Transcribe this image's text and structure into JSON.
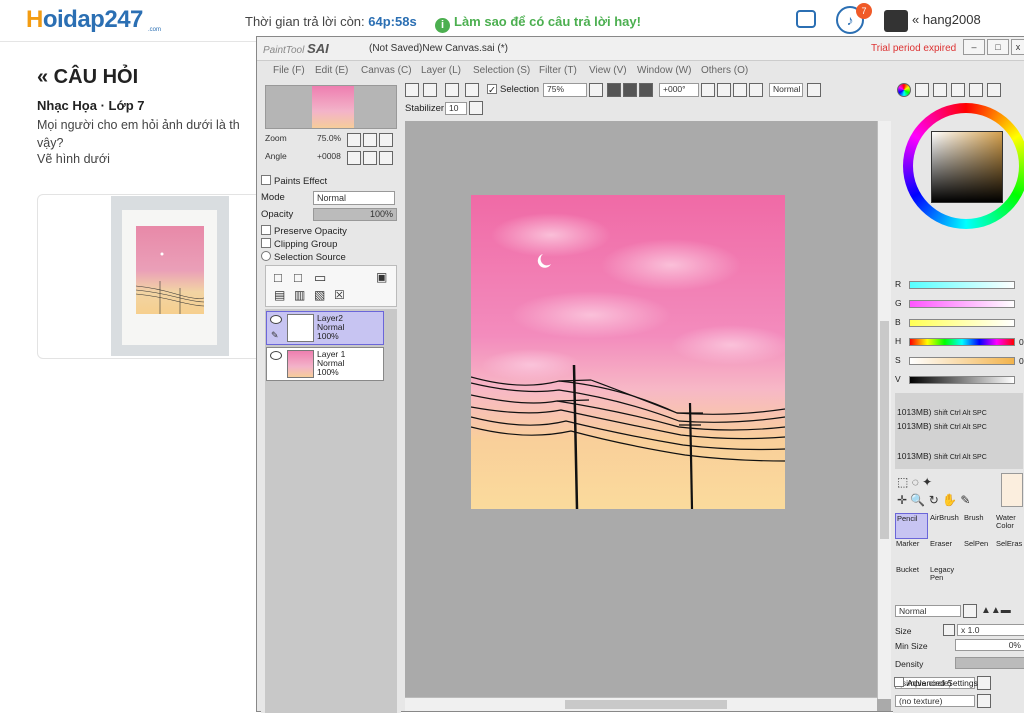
{
  "site": {
    "logo_part1": "H",
    "logo_part2": "oidap247",
    "logo_sub": ".com",
    "timer_label": "Thời gian trả lời còn:",
    "timer_value": "64p:58s",
    "tip_icon": "i",
    "tip": "Làm sao để có câu trả lời hay!",
    "notifications": "7",
    "username": "hang2008",
    "accent_color": "#2b6fb3"
  },
  "question": {
    "title": "« CÂU HỎI",
    "meta": "Nhạc Họa · Lớp 7",
    "text": "Mọi người cho em hỏi ảnh dưới là th vậy?",
    "text2": "Vẽ hình dưới"
  },
  "sai": {
    "logo_small": "PaintTool",
    "logo_big": "SAI",
    "doc_title": "(Not Saved)New Canvas.sai (*)",
    "trial": "Trial period expired",
    "menu": [
      "File (F)",
      "Edit (E)",
      "Canvas (C)",
      "Layer (L)",
      "Selection (S)",
      "Filter (T)",
      "View (V)",
      "Window (W)",
      "Others (O)"
    ],
    "toolbar": {
      "selection_label": "Selection",
      "zoom_value": "75%",
      "angle_value": "+000°",
      "blend_value": "Normal",
      "stabilizer_label": "Stabilizer",
      "stabilizer_value": "10"
    },
    "navigator": {
      "zoom_label": "Zoom",
      "zoom_value": "75.0%",
      "angle_label": "Angle",
      "angle_value": "+0008"
    },
    "layer_props": {
      "paints_effect": "Paints Effect",
      "mode_label": "Mode",
      "mode_value": "Normal",
      "opacity_label": "Opacity",
      "opacity_value": "100%",
      "preserve_opacity": "Preserve Opacity",
      "clipping_group": "Clipping Group",
      "selection_source": "Selection Source"
    },
    "layers": [
      {
        "name": "Layer2",
        "mode": "Normal",
        "opacity": "100%"
      },
      {
        "name": "Layer 1",
        "mode": "Normal",
        "opacity": "100%"
      }
    ],
    "color": {
      "r_label": "R",
      "g_label": "G",
      "b_label": "B",
      "h_label": "H",
      "s_label": "S",
      "v_label": "V",
      "h_value": "0",
      "s_value": "0"
    },
    "scratch_rows": [
      "1013MB)",
      "1013MB)",
      "1013MB)"
    ],
    "scratch_keys": "Shift Ctrl Alt SPC",
    "tools": [
      {
        "label": "Pencil",
        "selected": true
      },
      {
        "label": "AirBrush",
        "selected": false
      },
      {
        "label": "Brush",
        "selected": false
      },
      {
        "label": "Water Color",
        "selected": false
      },
      {
        "label": "Marker",
        "selected": false
      },
      {
        "label": "Eraser",
        "selected": false
      },
      {
        "label": "SelPen",
        "selected": false
      },
      {
        "label": "SelEras",
        "selected": false
      },
      {
        "label": "Bucket",
        "selected": false
      },
      {
        "label": "Legacy Pen",
        "selected": false
      }
    ],
    "brush": {
      "blend_value": "Normal",
      "size_label": "Size",
      "size_mult": "x 1.0",
      "min_size_label": "Min Size",
      "min_size_value": "0%",
      "density_label": "Density",
      "shape_value": "(simple circle)",
      "texture_value": "(no texture)",
      "advanced": "Advanced Settings"
    }
  }
}
